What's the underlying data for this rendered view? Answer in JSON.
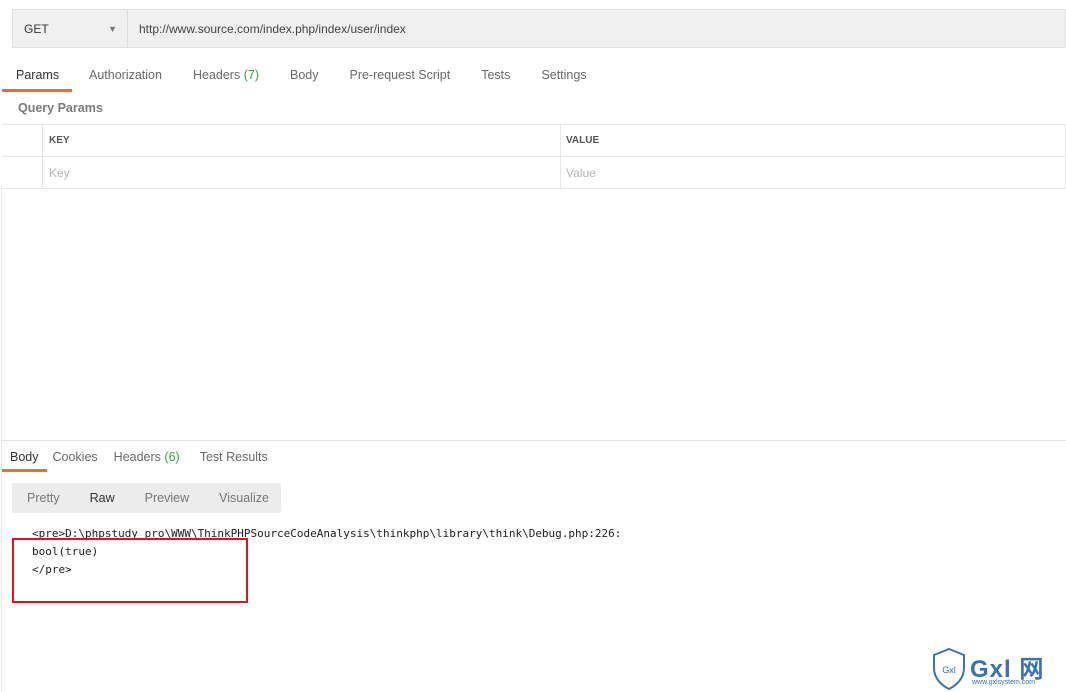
{
  "request": {
    "method": "GET",
    "url": "http://www.source.com/index.php/index/user/index"
  },
  "request_tabs": [
    {
      "label": "Params"
    },
    {
      "label": "Authorization"
    },
    {
      "label": "Headers",
      "count": "(7)"
    },
    {
      "label": "Body"
    },
    {
      "label": "Pre-request Script"
    },
    {
      "label": "Tests"
    },
    {
      "label": "Settings"
    }
  ],
  "query_params": {
    "title": "Query Params",
    "key_header": "KEY",
    "value_header": "VALUE",
    "key_placeholder": "Key",
    "value_placeholder": "Value"
  },
  "response_tabs": [
    {
      "label": "Body"
    },
    {
      "label": "Cookies"
    },
    {
      "label": "Headers",
      "count": "(6)"
    },
    {
      "label": "Test Results"
    }
  ],
  "view_modes": [
    "Pretty",
    "Raw",
    "Preview",
    "Visualize"
  ],
  "response_body": [
    "<pre>D:\\phpstudy_pro\\WWW\\ThinkPHPSourceCodeAnalysis\\thinkphp\\library\\think\\Debug.php:226:",
    "bool(true)",
    "</pre>"
  ],
  "watermark": {
    "logo_text": "Gxl 网",
    "url": "www.gxlsystem.com",
    "shield_text": "Gxl"
  },
  "colors": {
    "accent": "#f26b3a",
    "count_green": "#37a346",
    "highlight_red": "#e0141e",
    "watermark_blue": "#3a72b8"
  }
}
